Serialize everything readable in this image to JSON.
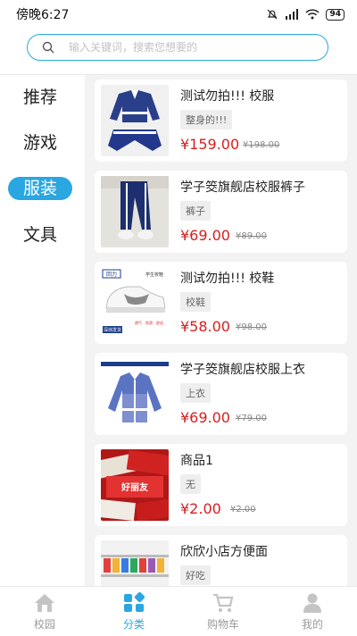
{
  "status": {
    "time": "傍晚6:27",
    "battery": "94"
  },
  "search": {
    "placeholder": "输入关键词，搜索您想要的"
  },
  "categories": [
    {
      "label": "推荐"
    },
    {
      "label": "游戏"
    },
    {
      "label": "服装"
    },
    {
      "label": "文具"
    }
  ],
  "active_category": "服装",
  "products": [
    {
      "name": "测试勿拍!!! 校服",
      "tag": "整身的!!!",
      "price": "¥159.00",
      "orig_price": "¥198.00",
      "image": "tracksuit"
    },
    {
      "name": "学子筊旗舰店校服裤子",
      "tag": "裤子",
      "price": "¥69.00",
      "orig_price": "¥89.00",
      "image": "pants"
    },
    {
      "name": "测试勿拍!!! 校鞋",
      "tag": "校鞋",
      "price": "¥58.00",
      "orig_price": "¥98.00",
      "image": "shoe",
      "brand_text": "回力",
      "shoe_caption": "学生校鞋",
      "shoe_badge": "深圳发货",
      "shoe_features": [
        "透气",
        "防滑",
        "舒适"
      ]
    },
    {
      "name": "学子筊旗舰店校服上衣",
      "tag": "上衣",
      "price": "¥69.00",
      "orig_price": "¥79.00",
      "image": "jacket"
    },
    {
      "name": "商品1",
      "tag": "无",
      "price": "¥2.00",
      "orig_price": "¥2.00",
      "image": "snack",
      "snack_text": "好丽友"
    },
    {
      "name": "欣欣小店方便面",
      "tag": "好吃",
      "price": "",
      "orig_price": "",
      "image": "shelf"
    }
  ],
  "tabs": [
    {
      "label": "校园",
      "icon": "home-icon"
    },
    {
      "label": "分类",
      "icon": "category-icon"
    },
    {
      "label": "购物车",
      "icon": "cart-icon"
    },
    {
      "label": "我的",
      "icon": "user-icon"
    }
  ],
  "active_tab": "分类",
  "colors": {
    "accent": "#2aa6e0",
    "price": "#d81e1e"
  }
}
